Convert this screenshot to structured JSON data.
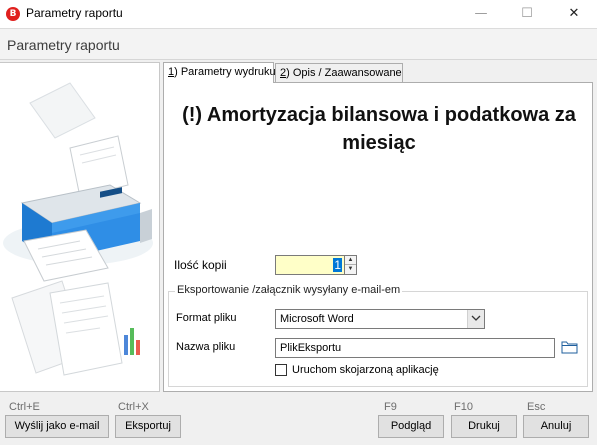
{
  "window": {
    "title": "Parametry raportu",
    "icon_letter": "B",
    "controls": {
      "minimize": "—",
      "maximize": "☐",
      "close": "✕"
    }
  },
  "header": {
    "title": "Parametry raportu"
  },
  "tabs": [
    {
      "key": "1",
      "label": ") Parametry wydruku",
      "active": true
    },
    {
      "key": "2",
      "label": ") Opis / Zaawansowane",
      "active": false
    }
  ],
  "report": {
    "title_line1": "(!) Amortyzacja bilansowa i podatkowa za",
    "title_line2": "miesiąc"
  },
  "copies": {
    "label": "Ilość kopii",
    "value": "1"
  },
  "export_group": {
    "legend": "Eksportowanie /załącznik wysyłany e-mail-em",
    "format_label": "Format pliku",
    "format_value": "Microsoft Word",
    "filename_label": "Nazwa pliku",
    "filename_value": "PlikEksportu",
    "open_app_label": "Uruchom skojarzoną aplikację",
    "open_app_checked": false
  },
  "footer": {
    "email": {
      "hotkey": "Ctrl+E",
      "label": "Wyślij jako e-mail"
    },
    "export": {
      "hotkey": "Ctrl+X",
      "label": "Eksportuj"
    },
    "preview": {
      "hotkey": "F9",
      "label": "Podgląd"
    },
    "print": {
      "hotkey": "F10",
      "label": "Drukuj"
    },
    "cancel": {
      "hotkey": "Esc",
      "label": "Anuluj"
    }
  },
  "colors": {
    "accent": "#0078d7",
    "copies_bg": "#ffffc8",
    "app_icon": "#e0201e"
  }
}
